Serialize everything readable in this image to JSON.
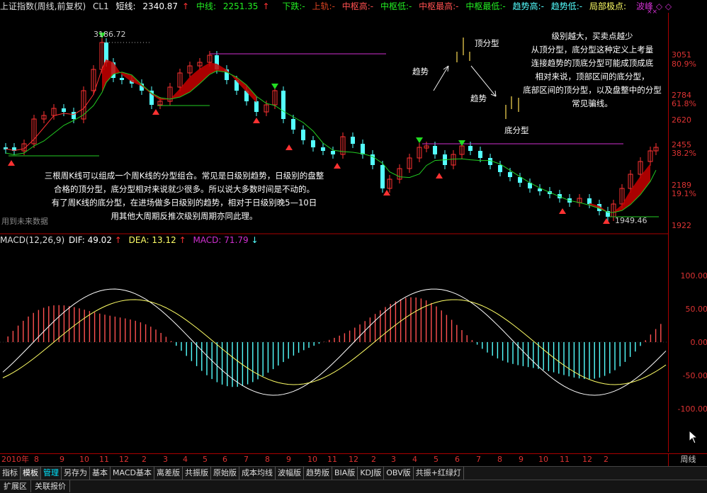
{
  "header": {
    "title": "上证指数(周线,前复权)",
    "indicator": "CL1",
    "short_label": "短线:",
    "short_value": "2340.87",
    "short_arrow": "↑",
    "mid_label": "中线:",
    "mid_value": "2251.35",
    "mid_arrow": "↑",
    "legends": [
      "下跌:-",
      "上轨:-",
      "中枢高:-",
      "中枢低:-",
      "中枢最高:-",
      "中枢最低:-",
      "趋势高:-",
      "趋势低:-",
      "局部极点:"
    ],
    "right_labels": [
      "波峰",
      "◇",
      "◇"
    ],
    "xx_mark": "××"
  },
  "price_axis": {
    "ticks": [
      {
        "label": "3051",
        "pct": "80.9%"
      },
      {
        "label": "2784",
        "pct": "61.8%"
      },
      {
        "label": "2620",
        "pct": ""
      },
      {
        "label": "2455",
        "pct": "38.2%"
      },
      {
        "label": "2189",
        "pct": "19.1%"
      },
      {
        "label": "1922",
        "pct": ""
      }
    ],
    "high_label": "3186.72",
    "low_label": "1949.46"
  },
  "annotations": {
    "top_pattern_label": "顶分型",
    "trend_up_label": "趋势",
    "trend_down_label": "趋势",
    "bottom_pattern_label": "底分型",
    "note_right": [
      "级别越大，买卖点越少",
      "从顶分型，底分型这种定义上考量",
      "连接趋势的顶底分型可能成顶成底",
      "相对来说，顶部区间的底分型，",
      "底部区间的顶分型，以及盘整中的分型",
      "常见骗线。"
    ],
    "note_left": [
      "三根周K线可以组成一个周K线的分型组合。常见是日级别趋势，日级别的盘整",
      "合格的顶分型，底分型相对来说就少很多。所以说大多数时间是不动的。",
      "有了周K线的底分型，在进场做多日级别的趋势，相对于日级别晚5—10日",
      "用其他大周期反推次级别周期亦同此理。"
    ],
    "future_data": "用到未来数据"
  },
  "macd": {
    "name": "MACD(12,26,9)",
    "dif_label": "DIF:",
    "dif_value": "49.02",
    "dif_arrow": "↑",
    "dea_label": "DEA:",
    "dea_value": "13.12",
    "dea_arrow": "↑",
    "macd_label": "MACD:",
    "macd_value": "71.79",
    "macd_arrow": "↓",
    "ticks": [
      "100.00",
      "50.00",
      "0.00",
      "-50.00",
      "-100.00"
    ]
  },
  "date_axis": {
    "labels": [
      "2010年",
      "8",
      "9",
      "10",
      "11",
      "12",
      "2",
      "3",
      "4",
      "5",
      "6",
      "7",
      "8",
      "9",
      "10",
      "11",
      "12",
      "2",
      "3",
      "4",
      "5",
      "6",
      "7",
      "8",
      "9",
      "10",
      "11",
      "12",
      "2"
    ],
    "period": "周线"
  },
  "tabs": [
    "指标",
    "模板",
    "管理",
    "另存为",
    "基本",
    "MACD基本",
    "离差版",
    "共振版",
    "原始版",
    "成本均线",
    "波幅版",
    "趋势版",
    "BIA版",
    "KDJ版",
    "OBV版",
    "共振+红绿灯"
  ],
  "bottom_tabs": [
    "扩展区",
    "关联报价"
  ],
  "colors": {
    "up": "#ff3232",
    "down": "#54ffff",
    "ma_short": "#ff3030",
    "ma_mid": "#22cc22",
    "dif": "#ffffff",
    "dea": "#ffff66",
    "magenta": "#d030d0"
  }
}
